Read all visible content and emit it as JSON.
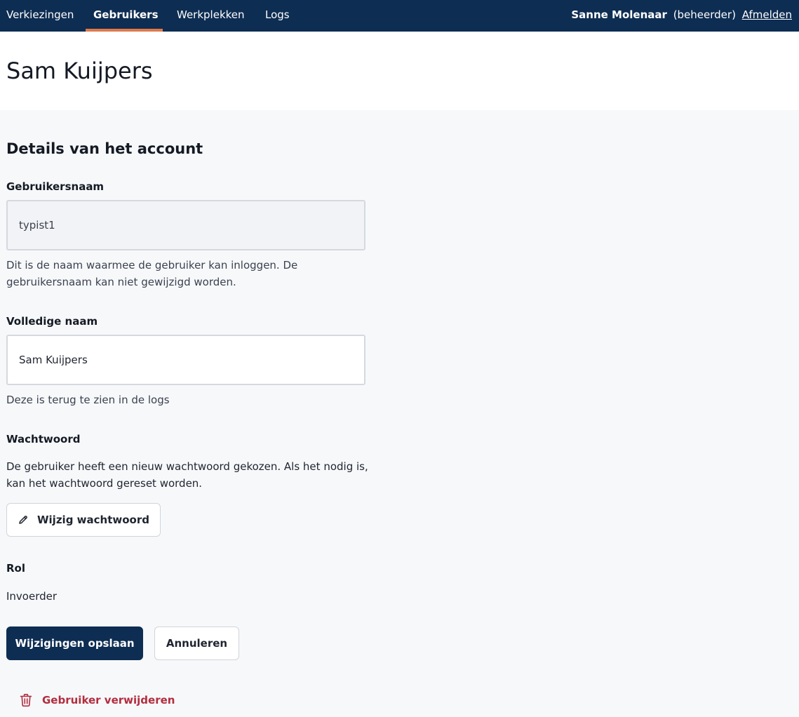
{
  "nav": {
    "items": [
      {
        "label": "Verkiezingen",
        "active": false
      },
      {
        "label": "Gebruikers",
        "active": true
      },
      {
        "label": "Werkplekken",
        "active": false
      },
      {
        "label": "Logs",
        "active": false
      }
    ],
    "user": {
      "name": "Sanne Molenaar",
      "role": "(beheerder)",
      "logout_label": "Afmelden"
    }
  },
  "page": {
    "title": "Sam Kuijpers"
  },
  "form": {
    "section_title": "Details van het account",
    "username": {
      "label": "Gebruikersnaam",
      "value": "typist1",
      "hint": "Dit is de naam waarmee de gebruiker kan inloggen. De gebruikersnaam kan niet gewijzigd worden."
    },
    "fullname": {
      "label": "Volledige naam",
      "value": "Sam Kuijpers",
      "hint": "Deze is terug te zien in de logs"
    },
    "password": {
      "label": "Wachtwoord",
      "text": "De gebruiker heeft een nieuw wachtwoord gekozen. Als het nodig is, kan het wachtwoord gereset worden.",
      "button_label": "Wijzig wachtwoord",
      "button_icon": "pencil-icon"
    },
    "role": {
      "label": "Rol",
      "value": "Invoerder"
    },
    "actions": {
      "save_label": "Wijzigingen opslaan",
      "cancel_label": "Annuleren",
      "delete_label": "Gebruiker verwijderen",
      "delete_icon": "trash-icon"
    }
  },
  "colors": {
    "nav_background": "#0e2d52",
    "nav_active_underline": "#e07a4b",
    "primary": "#0e2d52",
    "danger": "#b22d3e",
    "page_background": "#f7f8fa"
  }
}
